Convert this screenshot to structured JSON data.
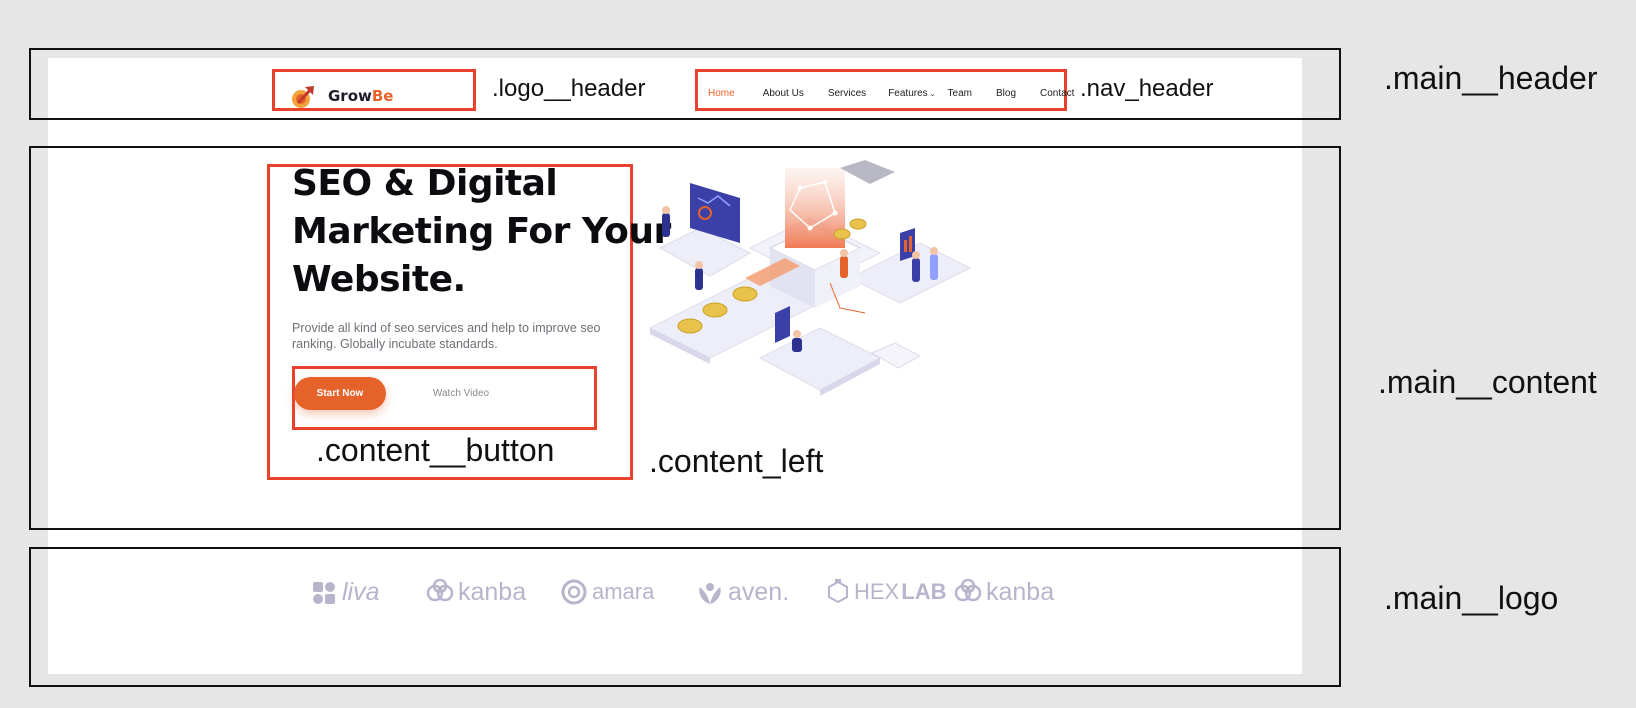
{
  "header": {
    "logo": {
      "prefix": "Grow",
      "accent": "Be"
    },
    "nav": [
      {
        "label": "Home",
        "active": true
      },
      {
        "label": "About Us",
        "active": false
      },
      {
        "label": "Services",
        "active": false
      },
      {
        "label": "Features",
        "active": false,
        "has_dropdown": true
      },
      {
        "label": "Team",
        "active": false
      },
      {
        "label": "Blog",
        "active": false
      },
      {
        "label": "Contact",
        "active": false
      }
    ]
  },
  "hero": {
    "title_lines": [
      "SEO & Digital",
      "Marketing For Your",
      "Website."
    ],
    "description": "Provide all kind of seo services and help to improve seo ranking. Globally incubate standards.",
    "start_button": "Start Now",
    "watch_button": "Watch Video"
  },
  "brands": [
    {
      "name": "liva",
      "icon": "puzzle-icon"
    },
    {
      "name": "kanba",
      "icon": "rings-icon"
    },
    {
      "name": "amara",
      "icon": "at-sign-icon"
    },
    {
      "name": "aven.",
      "icon": "lotus-icon"
    },
    {
      "name_regular": "HEX",
      "name_bold": "LAB",
      "icon": "flask-icon"
    },
    {
      "name": "kanba",
      "icon": "rings-icon"
    }
  ],
  "annotations": {
    "logo_header": ".logo__header",
    "nav_header": ".nav_header",
    "main_header": ".main__header",
    "main_content": ".main__content",
    "content_button": ".content__button",
    "content_left": ".content_left",
    "main_logo": ".main__logo"
  },
  "colors": {
    "accent": "#e5632a",
    "annotation_red": "#e8412c",
    "brand_gray": "#b7b4cc",
    "page_bg": "#e6e6e6"
  }
}
